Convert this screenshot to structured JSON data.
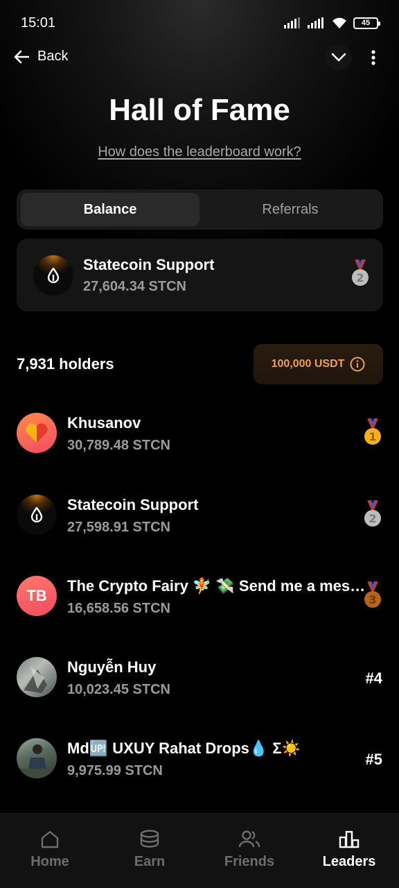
{
  "status_bar": {
    "time": "15:01",
    "battery": "45"
  },
  "nav": {
    "back_label": "Back"
  },
  "title": "Hall of Fame",
  "help_link": "How does the leaderboard work?",
  "tabs": [
    {
      "label": "Balance",
      "active": true
    },
    {
      "label": "Referrals",
      "active": false
    }
  ],
  "my_card": {
    "name": "Statecoin Support",
    "balance": "27,604.34 STCN",
    "place": 2
  },
  "holders_label": "7,931 holders",
  "prize_label": "100,000 USDT",
  "leaders": [
    {
      "name": "Khusanov",
      "balance": "30,789.48 STCN",
      "place": 1,
      "rank": ""
    },
    {
      "name": "Statecoin Support",
      "balance": "27,598.91 STCN",
      "place": 2,
      "rank": ""
    },
    {
      "name": "The Crypto Fairy 🧚 💸 Send me a mes…",
      "initials": "TB",
      "balance": "16,658.56 STCN",
      "place": 3,
      "rank": ""
    },
    {
      "name": "Nguyễn Huy",
      "balance": "10,023.45 STCN",
      "place": 4,
      "rank": "#4"
    },
    {
      "name": "Md🆙 UXUY Rahat Drops💧 Σ☀️",
      "balance": "9,975.99 STCN",
      "place": 5,
      "rank": "#5"
    }
  ],
  "bottom_nav": [
    {
      "label": "Home",
      "icon": "home-icon",
      "active": false
    },
    {
      "label": "Earn",
      "icon": "coins-icon",
      "active": false
    },
    {
      "label": "Friends",
      "icon": "friends-icon",
      "active": false
    },
    {
      "label": "Leaders",
      "icon": "leaderboard-icon",
      "active": true
    }
  ],
  "colors": {
    "accent_orange": "#f0a050",
    "gold": "#f2b01e",
    "silver": "#bdbdbd",
    "bronze": "#b5651d"
  }
}
